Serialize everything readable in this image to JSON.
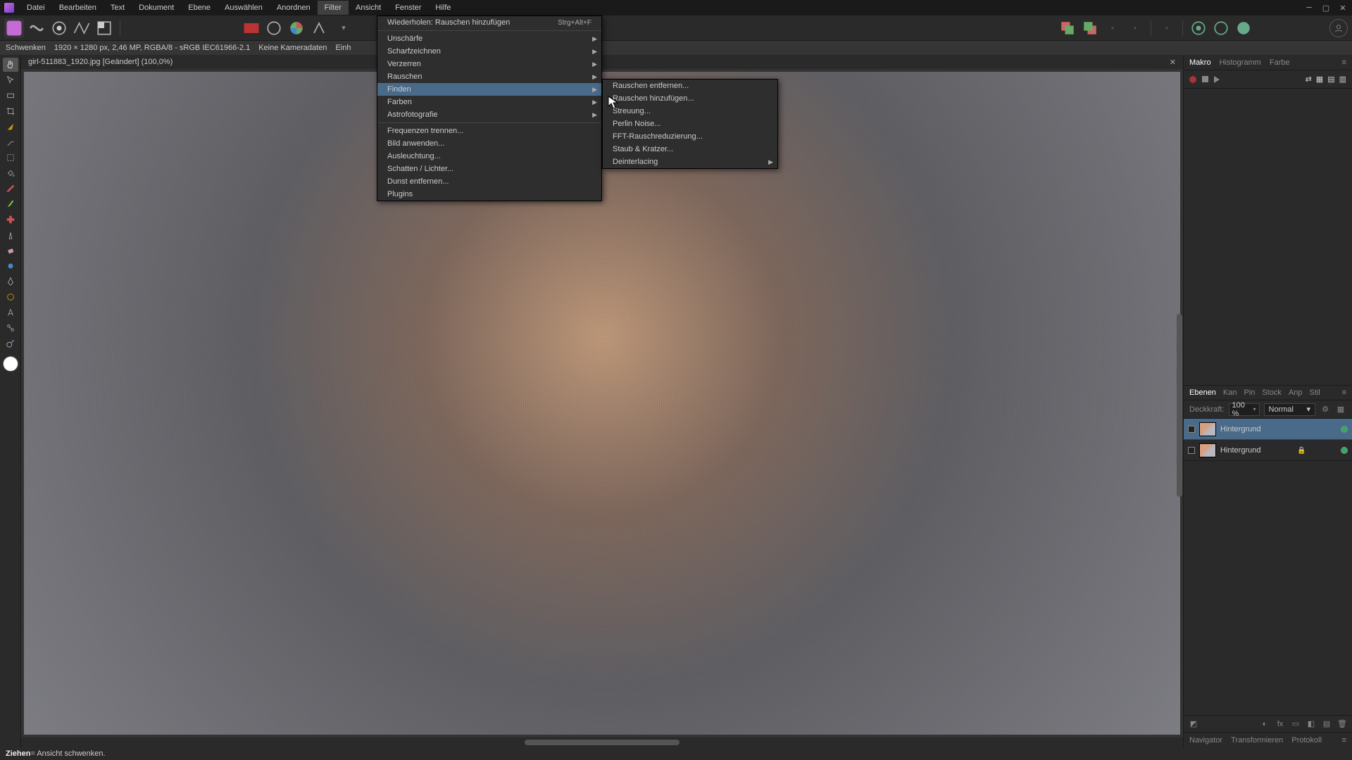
{
  "menubar": [
    "Datei",
    "Bearbeiten",
    "Text",
    "Dokument",
    "Ebene",
    "Auswählen",
    "Anordnen",
    "Filter",
    "Ansicht",
    "Fenster",
    "Hilfe"
  ],
  "active_menu_index": 7,
  "infobar": {
    "tool": "Schwenken",
    "dims": "1920 × 1280 px, 2,46 MP, RGBA/8 - sRGB IEC61966-2.1",
    "camera": "Keine Kameradaten",
    "unit": "Einh"
  },
  "doc_tab": {
    "name": "girl-511883_1920.jpg [Geändert] (100,0%)"
  },
  "filter_menu": {
    "repeat": {
      "label": "Wiederholen: Rauschen hinzufügen",
      "shortcut": "Strg+Alt+F"
    },
    "items": [
      {
        "label": "Unschärfe",
        "sub": true
      },
      {
        "label": "Scharfzeichnen",
        "sub": true
      },
      {
        "label": "Verzerren",
        "sub": true
      },
      {
        "label": "Rauschen",
        "sub": true
      },
      {
        "label": "Finden",
        "sub": true,
        "hover": true
      },
      {
        "label": "Farben",
        "sub": true
      },
      {
        "label": "Astrofotografie",
        "sub": true
      }
    ],
    "items2": [
      {
        "label": "Frequenzen trennen..."
      },
      {
        "label": "Bild anwenden..."
      },
      {
        "label": "Ausleuchtung..."
      },
      {
        "label": "Schatten / Lichter..."
      },
      {
        "label": "Dunst entfernen..."
      },
      {
        "label": "Plugins"
      }
    ]
  },
  "noise_submenu": [
    {
      "label": "Rauschen entfernen..."
    },
    {
      "label": "Rauschen hinzufügen..."
    },
    {
      "label": "Streuung..."
    },
    {
      "label": "Perlin Noise..."
    },
    {
      "label": "FFT-Rauschreduzierung..."
    },
    {
      "label": "Staub & Kratzer..."
    },
    {
      "label": "Deinterlacing",
      "sub": true
    }
  ],
  "right": {
    "top_tabs": [
      "Makro",
      "Histogramm",
      "Farbe"
    ],
    "layers_tabs": [
      "Ebenen",
      "Kan",
      "Pin",
      "Stock",
      "Anp",
      "Stil"
    ],
    "opacity_label": "Deckkraft:",
    "opacity_value": "100 %",
    "blend_mode": "Normal",
    "layers": [
      {
        "name": "Hintergrund",
        "selected": true,
        "visible": true
      },
      {
        "name": "Hintergrund",
        "selected": false,
        "visible": true,
        "locked": true
      }
    ],
    "bottom_tabs": [
      "Navigator",
      "Transformieren",
      "Protokoll"
    ]
  },
  "statusbar": {
    "action": "Ziehen",
    "desc": " = Ansicht schwenken."
  }
}
